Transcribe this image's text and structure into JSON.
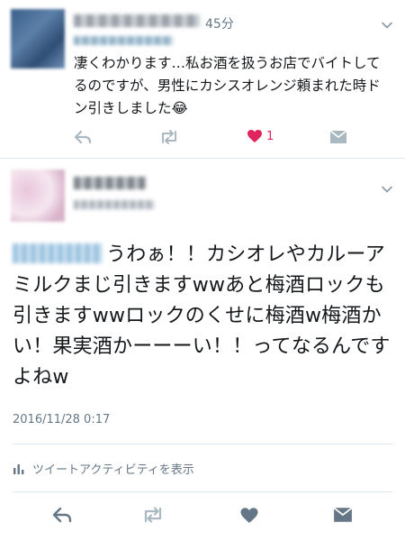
{
  "tweet1": {
    "time": "45分",
    "text": "凄くわかります…私お酒を扱うお店でバイトしてるのですが、男性にカシスオレンジ頼まれた時ドン引きしました😂",
    "like_count": "1"
  },
  "tweet2": {
    "text": "うわぁ！！カシオレやカルーアミルクまじ引きますwwあと梅酒ロックも引きますwwロックのくせに梅酒w梅酒かい！果実酒かーーーい！！ってなるんですよねw",
    "date": "2016/11/28 0:17",
    "activity_label": "ツイートアクティビティを表示"
  },
  "colors": {
    "like_active": "#e0245e",
    "icon_gray": "#aab8c2",
    "icon_dark": "#657786"
  },
  "icons": [
    "reply-icon",
    "retweet-icon",
    "heart-icon",
    "dm-icon",
    "chevron-down-icon",
    "bar-chart-icon"
  ]
}
